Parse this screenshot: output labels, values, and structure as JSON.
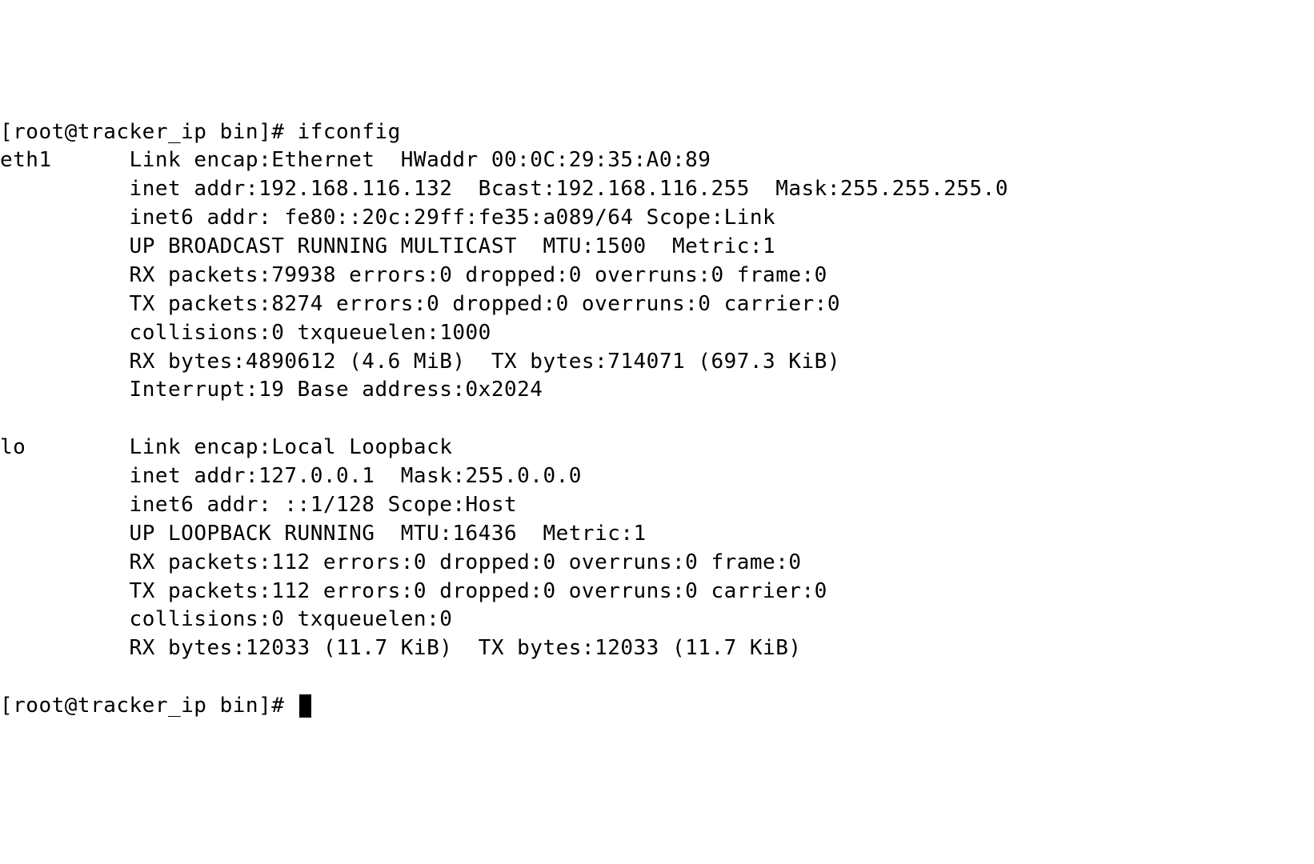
{
  "terminal": {
    "prompt1": "[root@tracker_ip bin]# ",
    "command1": "ifconfig",
    "interfaces": [
      {
        "name": "eth1",
        "lines": [
          "Link encap:Ethernet  HWaddr 00:0C:29:35:A0:89",
          "inet addr:192.168.116.132  Bcast:192.168.116.255  Mask:255.255.255.0",
          "inet6 addr: fe80::20c:29ff:fe35:a089/64 Scope:Link",
          "UP BROADCAST RUNNING MULTICAST  MTU:1500  Metric:1",
          "RX packets:79938 errors:0 dropped:0 overruns:0 frame:0",
          "TX packets:8274 errors:0 dropped:0 overruns:0 carrier:0",
          "collisions:0 txqueuelen:1000",
          "RX bytes:4890612 (4.6 MiB)  TX bytes:714071 (697.3 KiB)",
          "Interrupt:19 Base address:0x2024"
        ]
      },
      {
        "name": "lo",
        "lines": [
          "Link encap:Local Loopback",
          "inet addr:127.0.0.1  Mask:255.0.0.0",
          "inet6 addr: ::1/128 Scope:Host",
          "UP LOOPBACK RUNNING  MTU:16436  Metric:1",
          "RX packets:112 errors:0 dropped:0 overruns:0 frame:0",
          "TX packets:112 errors:0 dropped:0 overruns:0 carrier:0",
          "collisions:0 txqueuelen:0",
          "RX bytes:12033 (11.7 KiB)  TX bytes:12033 (11.7 KiB)"
        ]
      }
    ],
    "prompt2": "[root@tracker_ip bin]# "
  },
  "indent": {
    "iface_col_width": 10,
    "body_indent": "          "
  }
}
